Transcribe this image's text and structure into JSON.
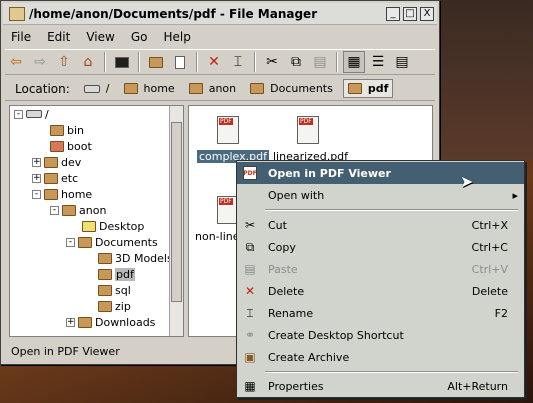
{
  "window": {
    "title": "/home/anon/Documents/pdf - File Manager",
    "controls": [
      "_",
      "□",
      "X"
    ]
  },
  "menu": [
    "File",
    "Edit",
    "View",
    "Go",
    "Help"
  ],
  "toolbar": {
    "icons": [
      "back-icon",
      "forward-icon",
      "up-icon",
      "home-icon",
      "terminal-icon",
      "new-folder-icon",
      "new-file-icon",
      "delete-icon",
      "rename-icon",
      "cut-icon",
      "copy-icon",
      "paste-icon",
      "icon-view-icon",
      "list-view-icon",
      "detail-view-icon"
    ]
  },
  "location": {
    "label": "Location:",
    "crumbs": [
      "/",
      "home",
      "anon",
      "Documents",
      "pdf"
    ]
  },
  "tree": [
    {
      "label": "/",
      "depth": 0,
      "expander": "-"
    },
    {
      "label": "bin",
      "depth": 1,
      "expander": ""
    },
    {
      "label": "boot",
      "depth": 1,
      "expander": ""
    },
    {
      "label": "dev",
      "depth": 1,
      "expander": "+"
    },
    {
      "label": "etc",
      "depth": 1,
      "expander": "+"
    },
    {
      "label": "home",
      "depth": 1,
      "expander": "-"
    },
    {
      "label": "anon",
      "depth": 2,
      "expander": "-"
    },
    {
      "label": "Desktop",
      "depth": 3,
      "expander": ""
    },
    {
      "label": "Documents",
      "depth": 3,
      "expander": "-"
    },
    {
      "label": "3D Models",
      "depth": 4,
      "expander": ""
    },
    {
      "label": "pdf",
      "depth": 4,
      "expander": ""
    },
    {
      "label": "sql",
      "depth": 4,
      "expander": ""
    },
    {
      "label": "zip",
      "depth": 4,
      "expander": ""
    },
    {
      "label": "Downloads",
      "depth": 3,
      "expander": "+"
    }
  ],
  "files": [
    {
      "label": "complex.pdf"
    },
    {
      "label": "linearized.pdf"
    },
    {
      "label": "non-line"
    }
  ],
  "status": "Open in PDF Viewer",
  "context_menu": {
    "items": [
      {
        "label": "Open in PDF Viewer",
        "shortcut": "",
        "icon": "pdf-icon"
      },
      {
        "label": "Open with",
        "shortcut": "▸",
        "icon": ""
      },
      {
        "label": "Cut",
        "shortcut": "Ctrl+X",
        "icon": "cut-icon"
      },
      {
        "label": "Copy",
        "shortcut": "Ctrl+C",
        "icon": "copy-icon"
      },
      {
        "label": "Paste",
        "shortcut": "Ctrl+V",
        "icon": "paste-icon"
      },
      {
        "label": "Delete",
        "shortcut": "Delete",
        "icon": "delete-icon"
      },
      {
        "label": "Rename",
        "shortcut": "F2",
        "icon": "rename-icon"
      },
      {
        "label": "Create Desktop Shortcut",
        "shortcut": "",
        "icon": "shortcut-icon"
      },
      {
        "label": "Create Archive",
        "shortcut": "",
        "icon": "archive-icon"
      },
      {
        "label": "Properties",
        "shortcut": "Alt+Return",
        "icon": "properties-icon"
      }
    ]
  },
  "colors": {
    "accent": "#445f72",
    "window_bg": "#d4d0c8",
    "folder": "#c89858"
  }
}
